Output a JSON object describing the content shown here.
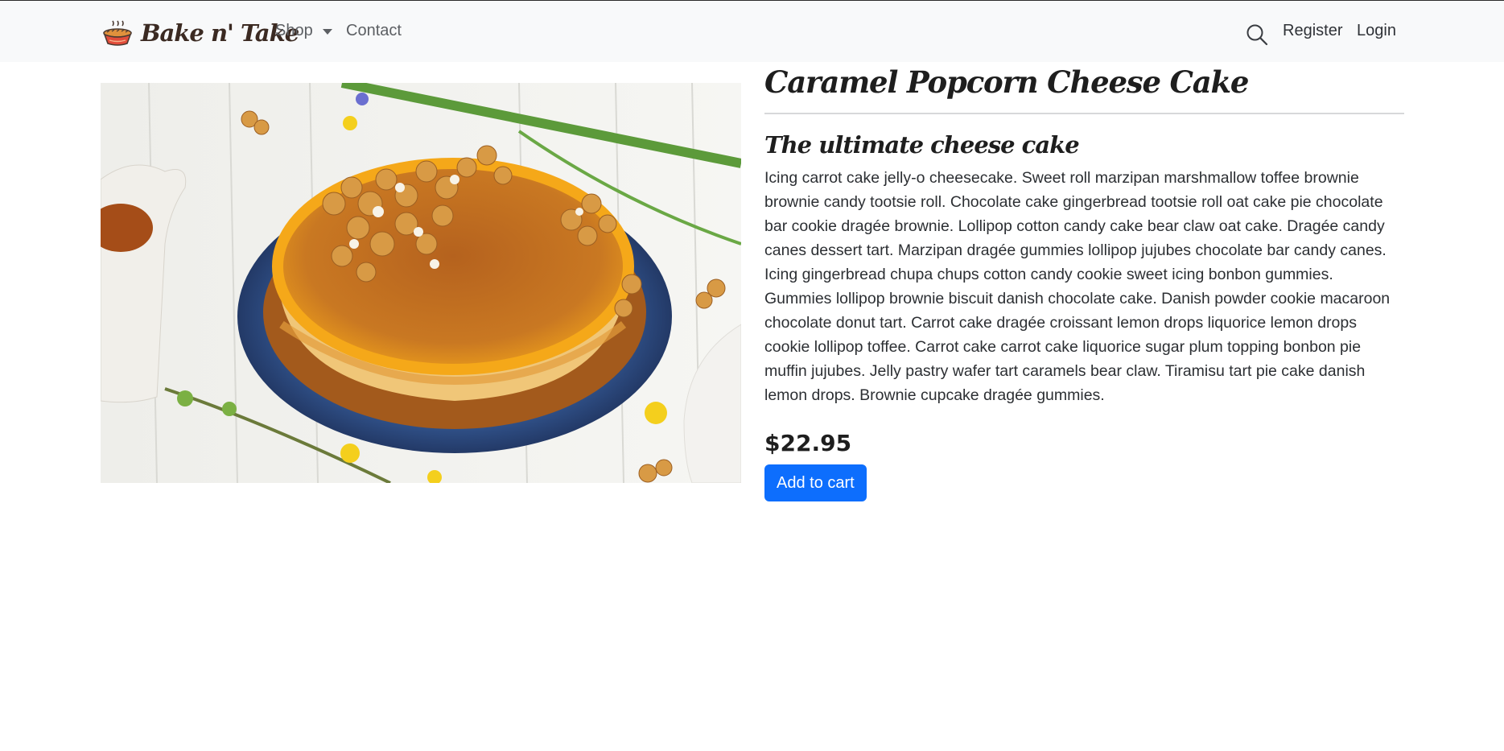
{
  "colors": {
    "navbar_bg": "#f8f9fa",
    "accent": "#0d6efd",
    "text": "#212529"
  },
  "navbar": {
    "brand": "Bake n' Take",
    "brand_icon": "pie-icon",
    "links": {
      "shop": "Shop",
      "contact": "Contact"
    },
    "search_icon": "search-icon",
    "register": "Register",
    "login": "Login"
  },
  "product": {
    "image_alt": "Caramel popcorn cheesecake on a blue plate",
    "title": "Caramel Popcorn Cheese Cake",
    "subtitle": "The ultimate cheese cake",
    "description": "Icing carrot cake jelly-o cheesecake. Sweet roll marzipan marshmallow toffee brownie brownie candy tootsie roll. Chocolate cake gingerbread tootsie roll oat cake pie chocolate bar cookie dragée brownie. Lollipop cotton candy cake bear claw oat cake. Dragée candy canes dessert tart. Marzipan dragée gummies lollipop jujubes chocolate bar candy canes. Icing gingerbread chupa chups cotton candy cookie sweet icing bonbon gummies. Gummies lollipop brownie biscuit danish chocolate cake. Danish powder cookie macaroon chocolate donut tart. Carrot cake dragée croissant lemon drops liquorice lemon drops cookie lollipop toffee. Carrot cake carrot cake liquorice sugar plum topping bonbon pie muffin jujubes. Jelly pastry wafer tart caramels bear claw. Tiramisu tart pie cake danish lemon drops. Brownie cupcake dragée gummies.",
    "price": "$22.95",
    "add_to_cart": "Add to cart"
  }
}
